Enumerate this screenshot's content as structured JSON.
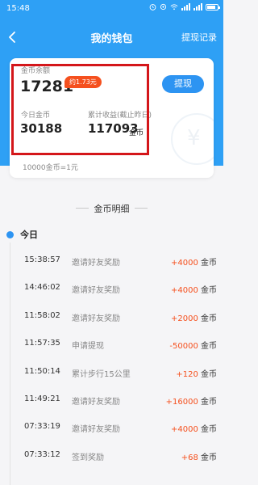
{
  "status_bar": {
    "time": "15:48"
  },
  "nav": {
    "title": "我的钱包",
    "withdraw_record": "提现记录"
  },
  "wallet": {
    "coin_balance_label": "金币余额",
    "coin_balance": "17281",
    "rmb_equivalent": "约1.73元",
    "withdraw_button": "提现",
    "today_coins_label": "今日金币",
    "today_coins": "30188",
    "cumulative_label": "累计收益(截止昨日)",
    "cumulative": "117093",
    "cumulative_unit": "金币",
    "exchange_rate": "10000金币=1元"
  },
  "details": {
    "title": "金币明细",
    "today_label": "今日",
    "unit": "金币",
    "records": [
      {
        "time": "15:38:57",
        "desc": "邀请好友奖励",
        "amount": "+4000"
      },
      {
        "time": "14:46:02",
        "desc": "邀请好友奖励",
        "amount": "+4000"
      },
      {
        "time": "11:58:02",
        "desc": "邀请好友奖励",
        "amount": "+2000"
      },
      {
        "time": "11:57:35",
        "desc": "申请提现",
        "amount": "-50000"
      },
      {
        "time": "11:50:14",
        "desc": "累计步行15公里",
        "amount": "+120"
      },
      {
        "time": "11:49:21",
        "desc": "邀请好友奖励",
        "amount": "+16000"
      },
      {
        "time": "07:33:19",
        "desc": "邀请好友奖励",
        "amount": "+4000"
      },
      {
        "time": "07:33:12",
        "desc": "签到奖励",
        "amount": "+68"
      }
    ]
  },
  "colors": {
    "header_blue": "#2ea0f5",
    "button_blue": "#2d94f2",
    "accent_orange": "#f5501e",
    "highlight_red": "#d4161a"
  }
}
